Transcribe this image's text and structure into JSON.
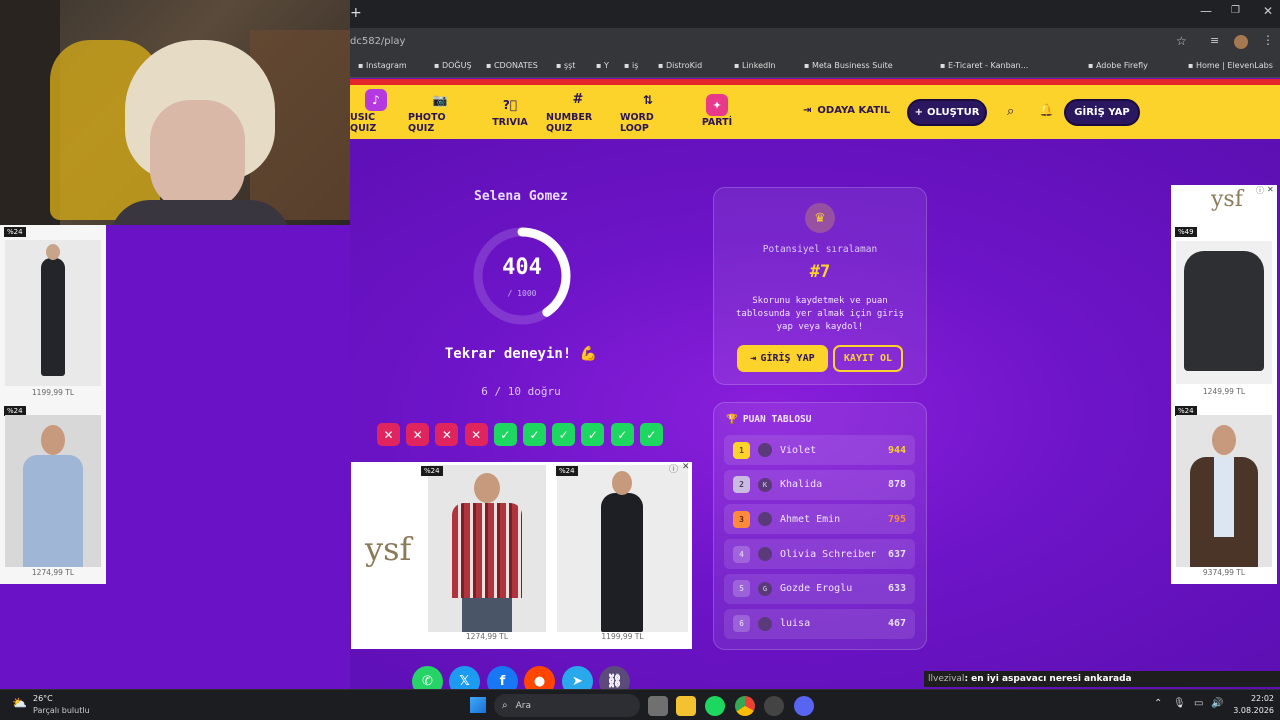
{
  "browser": {
    "url": "dc582/play",
    "bookmarks": [
      "Instagram",
      "DOĞUŞ",
      "CDONATES",
      "şşt",
      "Y",
      "iş",
      "DistroKid",
      "LinkedIn",
      "Meta Business Suite",
      "E-Ticaret - Kanban...",
      "Adobe Firefly",
      "Home | ElevenLabs"
    ]
  },
  "nav": {
    "items": [
      "USIC QUIZ",
      "PHOTO QUIZ",
      "TRIVIA",
      "NUMBER QUIZ",
      "WORD LOOP",
      "PARTİ"
    ],
    "join": "ODAYA KATIL",
    "create": "OLUŞTUR",
    "login": "GİRİŞ YAP"
  },
  "result": {
    "artist": "Selena Gomez",
    "score": "404",
    "max": "/ 1000",
    "score_fraction": 0.404,
    "message": "Tekrar deneyin! 💪",
    "correct": "6 / 10 doğru",
    "answers": [
      false,
      false,
      false,
      false,
      true,
      true,
      true,
      true,
      true,
      true
    ]
  },
  "rank_card": {
    "label": "Potansiyel sıralaman",
    "rank": "#7",
    "text": "Skorunu kaydetmek ve puan tablosunda yer almak için giriş yap veya kaydol!",
    "login": "GİRİŞ YAP",
    "register": "KAYIT OL"
  },
  "leaderboard": {
    "title": "PUAN TABLOSU",
    "rows": [
      {
        "rank": "1",
        "initial": "",
        "name": "Violet",
        "score": "944",
        "color": "#fbd32a"
      },
      {
        "rank": "2",
        "initial": "K",
        "name": "Khalida",
        "score": "878",
        "color": "#e8e0f4"
      },
      {
        "rank": "3",
        "initial": "",
        "name": "Ahmet Emin",
        "score": "795",
        "color": "#ff8a3d"
      },
      {
        "rank": "4",
        "initial": "",
        "name": "Olivia Schreiber",
        "score": "637",
        "color": "#e8e0f4"
      },
      {
        "rank": "5",
        "initial": "G",
        "name": "Gozde Eroglu",
        "score": "633",
        "color": "#e8e0f4"
      },
      {
        "rank": "6",
        "initial": "",
        "name": "luisa",
        "score": "467",
        "color": "#e8e0f4"
      }
    ]
  },
  "ads": {
    "brand": "ysf",
    "left_prices": [
      "1199,99 TL",
      "1274,99 TL"
    ],
    "center_prices": [
      "1274,99 TL",
      "1199,99 TL"
    ],
    "right_prices": [
      "1249,99 TL",
      "9374,99 TL"
    ],
    "badges": [
      "%24",
      "%24",
      "%24",
      "%24",
      "%49",
      "%24"
    ]
  },
  "ticker": {
    "user": "llvezival",
    "message": ": en iyi aspavacı neresi ankarada"
  },
  "taskbar": {
    "temp": "26°C",
    "weather": "Parçalı bulutlu",
    "search": "Ara",
    "time": "22:02",
    "date": "3.08.2026"
  }
}
